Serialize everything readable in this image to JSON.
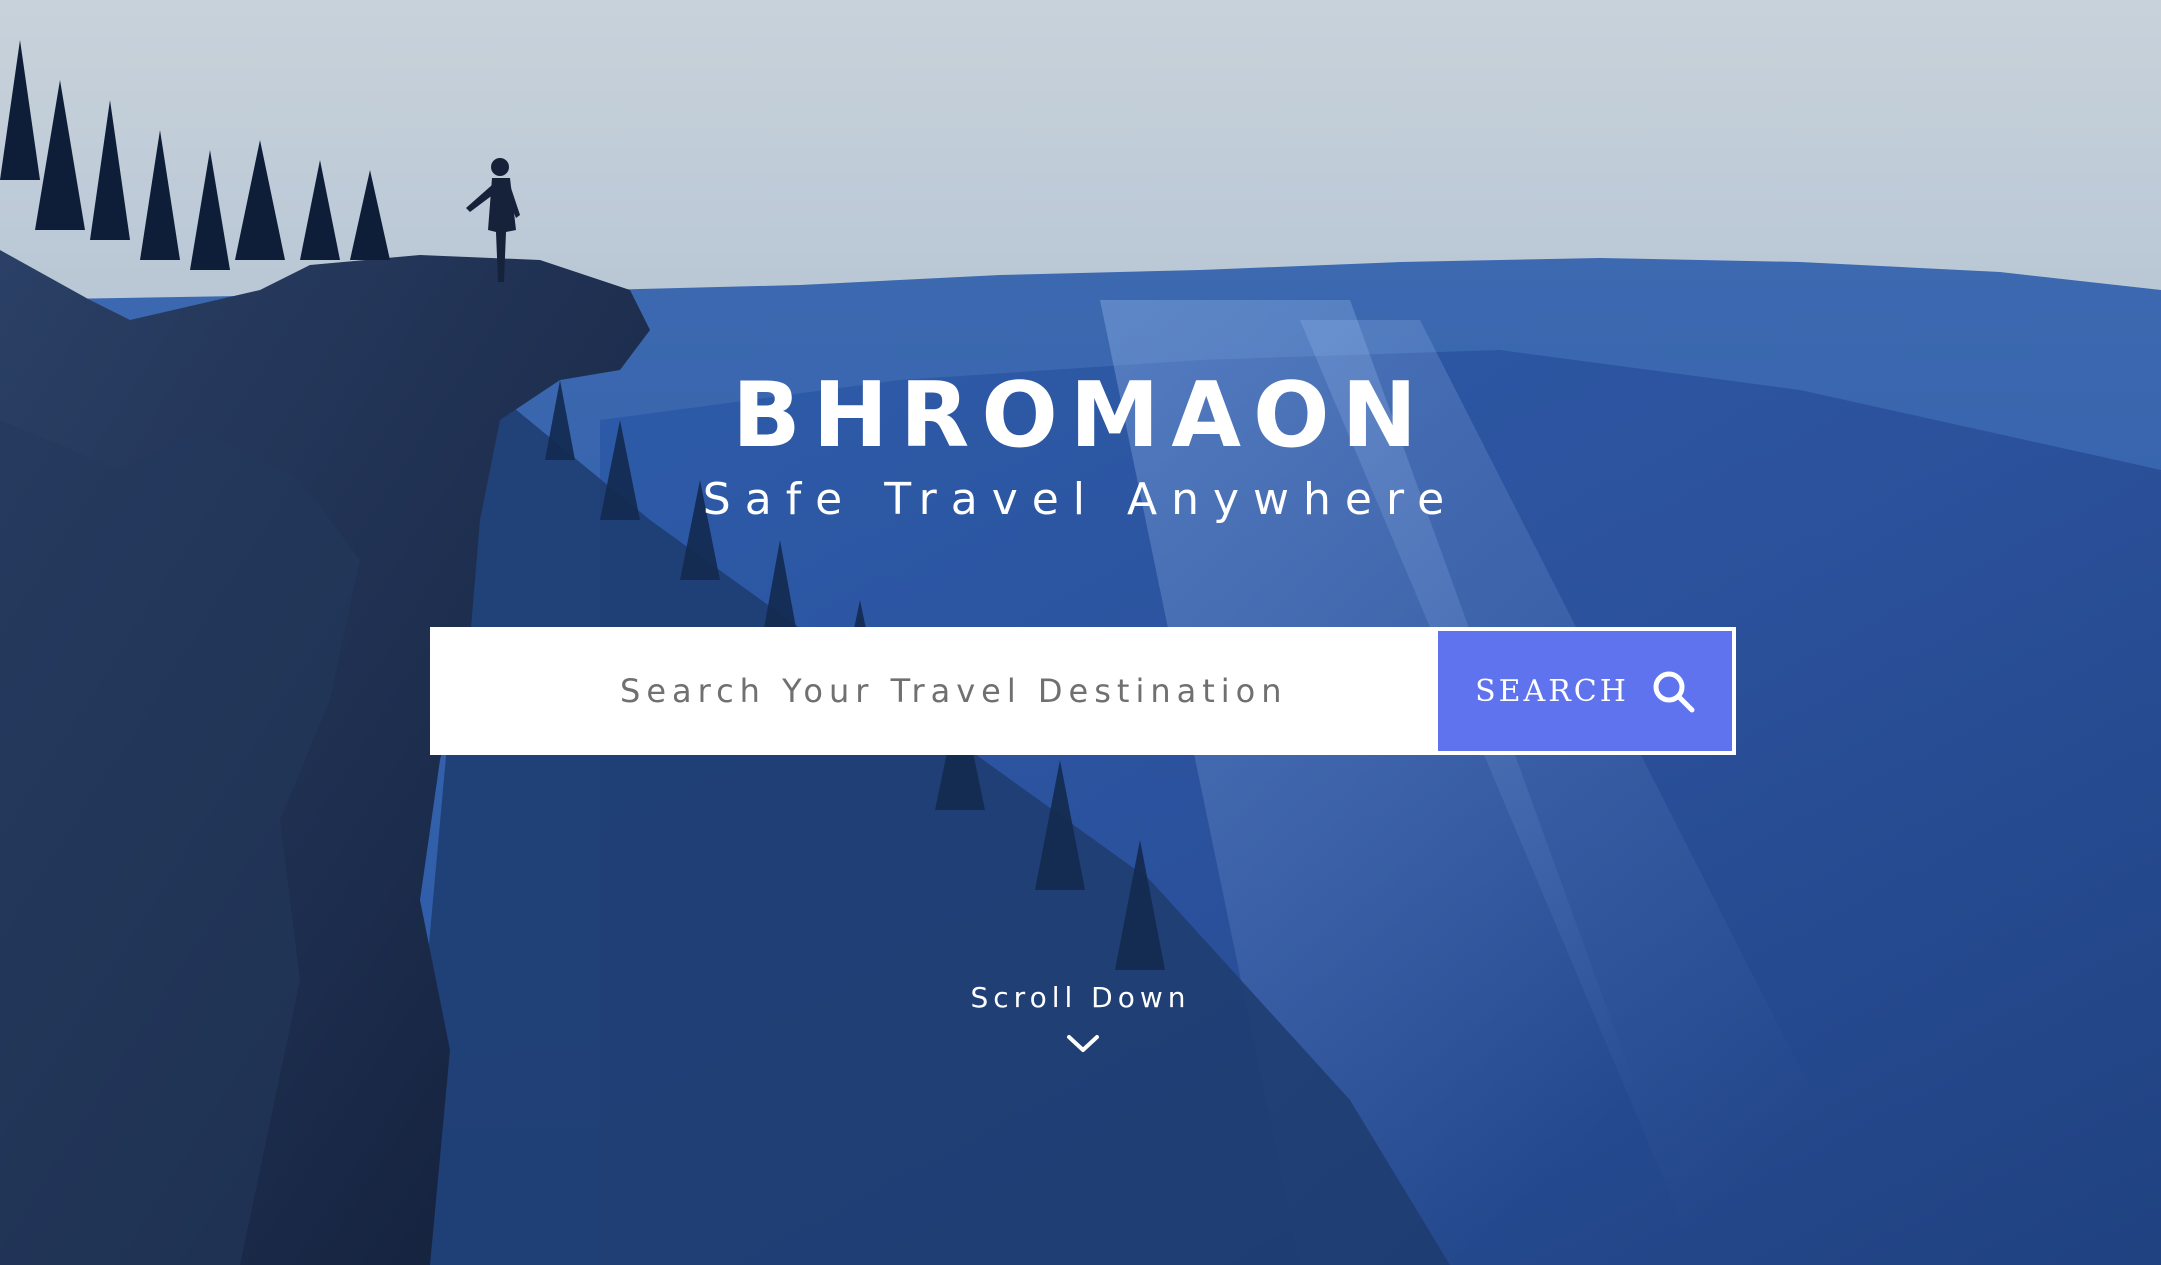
{
  "brand": {
    "title": "BHROMAON",
    "tagline": "Safe Travel Anywhere"
  },
  "search": {
    "placeholder": "Search Your Travel Destination",
    "value": "",
    "button_label": "SEARCH",
    "button_icon": "search-icon",
    "accent_color": "#5f73ef"
  },
  "scroll": {
    "label": "Scroll Down",
    "icon": "chevron-down-icon"
  },
  "background": {
    "subject": "person-standing-on-cliff-over-forested-mountain-valley"
  }
}
